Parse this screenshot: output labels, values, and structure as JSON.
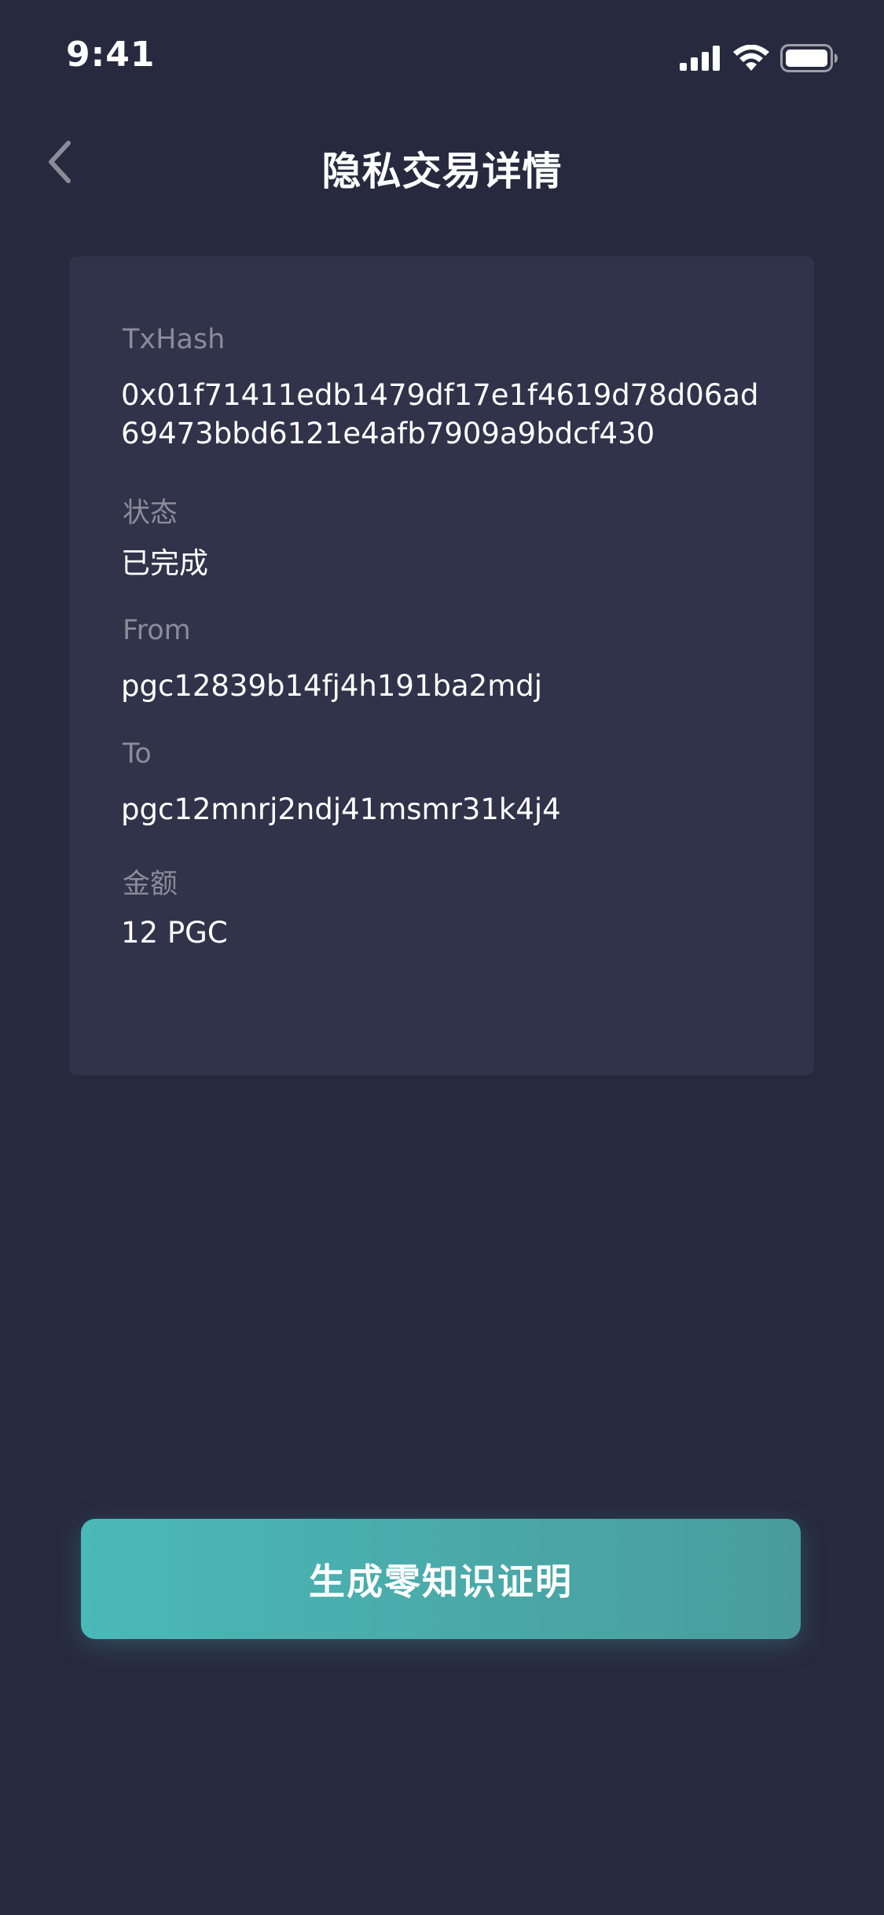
{
  "status_bar": {
    "time": "9:41",
    "icons": [
      "signal-icon",
      "wifi-icon",
      "battery-icon"
    ]
  },
  "nav": {
    "title": "隐私交易详情",
    "back_icon": "chevron-left-icon"
  },
  "details": {
    "txhash_label": "TxHash",
    "txhash_value": "0x01f71411edb1479df17e1f4619d78d06ad69473bbd6121e4afb7909a9bdcf430",
    "status_label": "状态",
    "status_value": "已完成",
    "from_label": "From",
    "from_value": "pgc12839b14fj4h191ba2mdj",
    "to_label": "To",
    "to_value": "pgc12mnrj2ndj41msmr31k4j4",
    "amount_label": "金额",
    "amount_value": "12 PGC"
  },
  "actions": {
    "generate_proof_label": "生成零知识证明"
  },
  "colors": {
    "background": "#272a3e",
    "card": "#303349",
    "label": "#8a8c99",
    "accent_start": "#4ab9b8",
    "accent_end": "#4a9c9c"
  }
}
